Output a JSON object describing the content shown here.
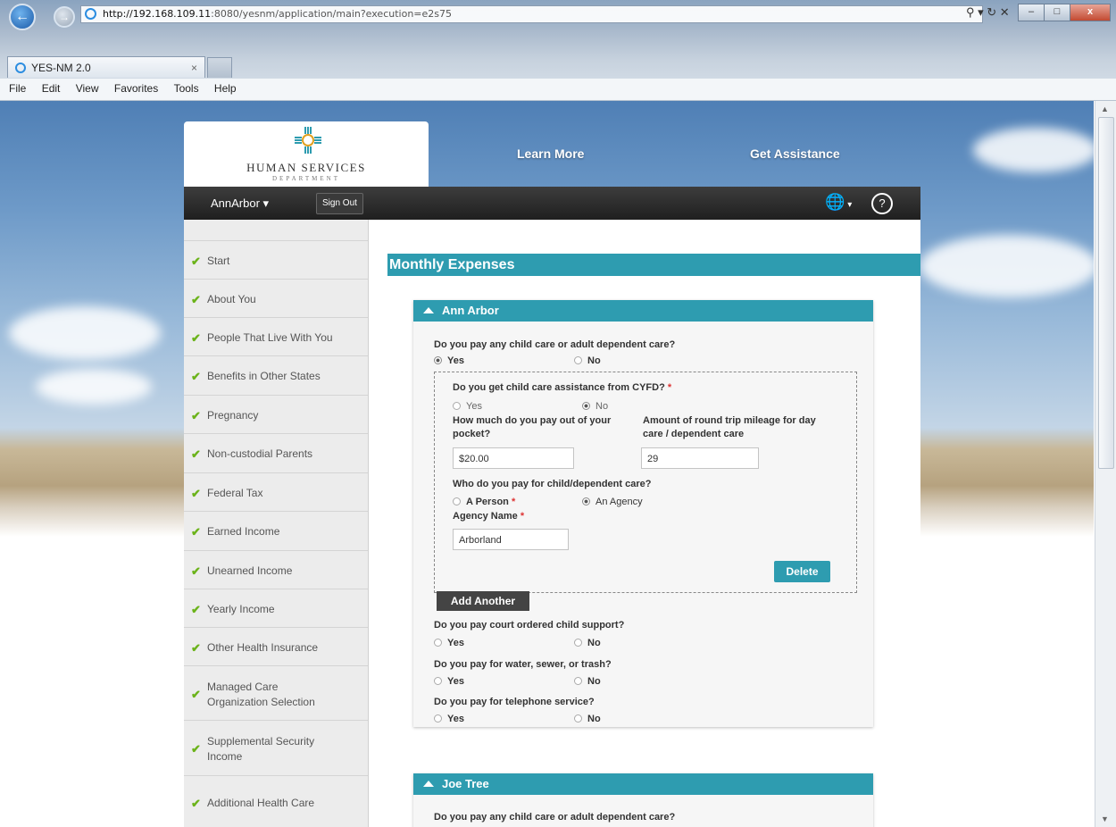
{
  "browser": {
    "url_host": "http://192.168.109.11",
    "url_rest": ":8080/yesnm/application/main?execution=e2s75",
    "tab_title": "YES-NM 2.0",
    "menu": [
      "File",
      "Edit",
      "View",
      "Favorites",
      "Tools",
      "Help"
    ]
  },
  "site": {
    "logo_text": "HUMAN SERVICES",
    "logo_dept": "DEPARTMENT",
    "learn_more": "Learn More",
    "get_assistance": "Get Assistance",
    "user": "AnnArbor",
    "sign_out": "Sign Out"
  },
  "sidebar": {
    "items": [
      {
        "label": "Start"
      },
      {
        "label": "About You"
      },
      {
        "label": "People That Live With You"
      },
      {
        "label": "Benefits in Other States"
      },
      {
        "label": "Pregnancy"
      },
      {
        "label": "Non-custodial Parents"
      },
      {
        "label": "Federal Tax"
      },
      {
        "label": "Earned Income"
      },
      {
        "label": "Unearned Income"
      },
      {
        "label": "Yearly Income"
      },
      {
        "label": "Other Health Insurance"
      },
      {
        "label": "Managed Care",
        "label2": "Organization Selection"
      },
      {
        "label": "Supplemental Security",
        "label2": "Income"
      },
      {
        "label": "Additional Health Care"
      }
    ]
  },
  "main": {
    "title": "Monthly Expenses",
    "panel1": {
      "name": "Ann Arbor",
      "q_childcare": "Do you pay any child care or adult dependent care?",
      "yes": "Yes",
      "no": "No",
      "q_cyfd": "Do you get child care assistance from CYFD?",
      "q_pocket_1": "How much do you pay out of your",
      "q_pocket_2": "pocket?",
      "q_mileage_1": "Amount of round trip mileage for day",
      "q_mileage_2": "care / dependent care",
      "pocket_value": "$20.00",
      "mileage_value": "29",
      "q_who": "Who do you pay for child/dependent care?",
      "a_person": "A Person",
      "an_agency": "An Agency",
      "agency_label": "Agency Name",
      "agency_value": "Arborland",
      "delete": "Delete",
      "add_another": "Add Another",
      "q_support": "Do you pay court ordered child support?",
      "q_water": "Do you pay for water, sewer, or trash?",
      "q_phone": "Do you pay for telephone service?"
    },
    "panel2": {
      "name": "Joe Tree",
      "q_childcare": "Do you pay any child care or adult dependent care?"
    }
  },
  "colors": {
    "accent": "#2e9cb0",
    "check": "#6bb31a",
    "required": "#dd3333"
  }
}
